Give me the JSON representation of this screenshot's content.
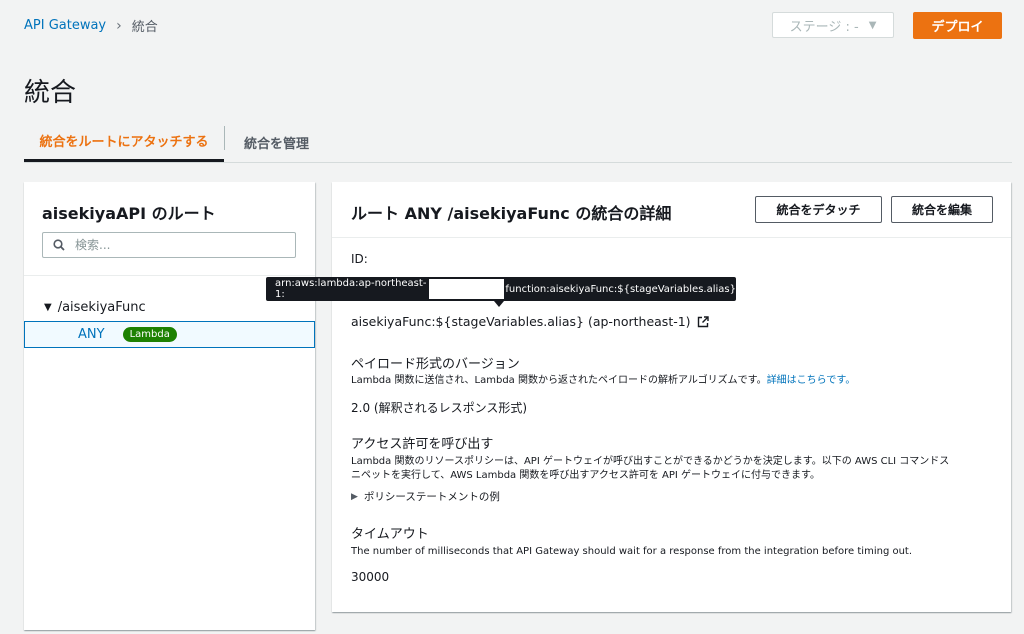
{
  "breadcrumb": {
    "root": "API Gateway",
    "current": "統合"
  },
  "header": {
    "stage_label": "ステージ : -",
    "deploy_label": "デプロイ"
  },
  "page": {
    "title": "統合"
  },
  "tabs": [
    {
      "label": "統合をルートにアタッチする",
      "active": true
    },
    {
      "label": "統合を管理",
      "active": false
    }
  ],
  "routes_panel": {
    "title": "aisekiyaAPI のルート",
    "search_placeholder": "検索...",
    "tree": {
      "root": "/aisekiyaFunc",
      "child_method": "ANY",
      "child_badge": "Lambda"
    }
  },
  "details": {
    "title": "ルート ANY /aisekiyaFunc の統合の詳細",
    "detach_label": "統合をデタッチ",
    "edit_label": "統合を編集",
    "id_label": "ID:",
    "tooltip_prefix": "arn:aws:lambda:ap-northeast-1:",
    "tooltip_suffix": "function:aisekiyaFunc:${stageVariables.alias}",
    "function_value": "aisekiyaFunc:${stageVariables.alias} (ap-northeast-1)",
    "payload_label": "ペイロード形式のバージョン",
    "payload_desc": "Lambda 関数に送信され、Lambda 関数から返されたペイロードの解析アルゴリズムです。",
    "payload_link": "詳細はこちらです。",
    "payload_value": "2.0 (解釈されるレスポンス形式)",
    "access_label": "アクセス許可を呼び出す",
    "access_desc_1": "Lambda 関数のリソースポリシーは、API ゲートウェイが呼び出すことができるかどうかを決定します。以下の AWS CLI コマンドス",
    "access_desc_2": "ニペットを実行して、AWS Lambda 関数を呼び出すアクセス許可を API ゲートウェイに付与できます。",
    "policy_toggle": "ポリシーステートメントの例",
    "timeout_label": "タイムアウト",
    "timeout_desc": "The number of milliseconds that API Gateway should wait for a response from the integration before timing out.",
    "timeout_value": "30000"
  },
  "colors": {
    "accent": "#ec7211",
    "link": "#0073bb",
    "badge": "#1d8102"
  }
}
